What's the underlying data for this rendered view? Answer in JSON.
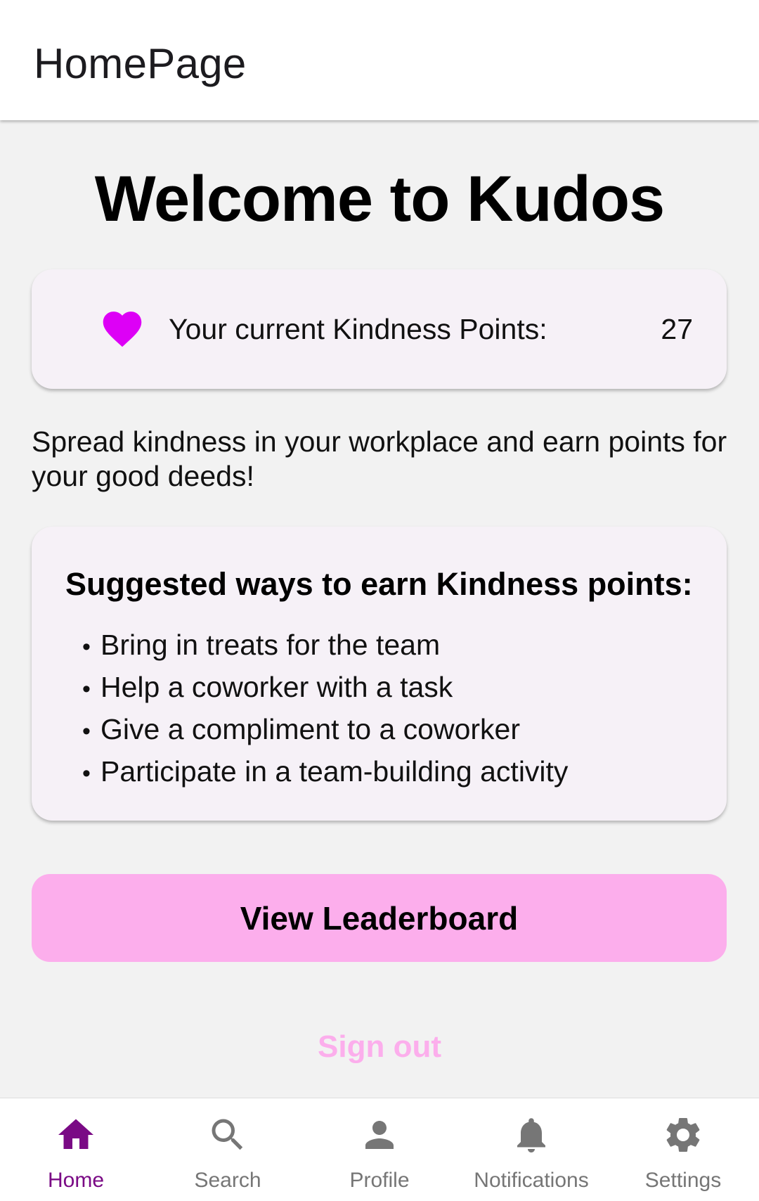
{
  "app_bar": {
    "title": "HomePage"
  },
  "main": {
    "welcome_title": "Welcome to Kudos",
    "points_card": {
      "icon": "heart-icon",
      "icon_color": "#dd00f6",
      "label": "Your current Kindness Points:",
      "value": "27"
    },
    "intro_text": "Spread kindness in your workplace and earn points for your good deeds!",
    "suggestions": {
      "title": "Suggested ways to earn Kindness points:",
      "bullet": "•",
      "items": [
        "Bring in treats for the team",
        "Help a coworker with a task",
        "Give a compliment to a coworker",
        "Participate in a team-building activity"
      ]
    },
    "leaderboard_button": "View Leaderboard",
    "leaderboard_button_color": "#fcaeec",
    "signout_button": "Sign out"
  },
  "bottom_nav": {
    "active_color": "#7a0a85",
    "inactive_color": "#767676",
    "items": [
      {
        "label": "Home",
        "icon": "home-icon",
        "active": true
      },
      {
        "label": "Search",
        "icon": "search-icon",
        "active": false
      },
      {
        "label": "Profile",
        "icon": "person-icon",
        "active": false
      },
      {
        "label": "Notifications",
        "icon": "bell-icon",
        "active": false
      },
      {
        "label": "Settings",
        "icon": "gear-icon",
        "active": false
      }
    ]
  }
}
